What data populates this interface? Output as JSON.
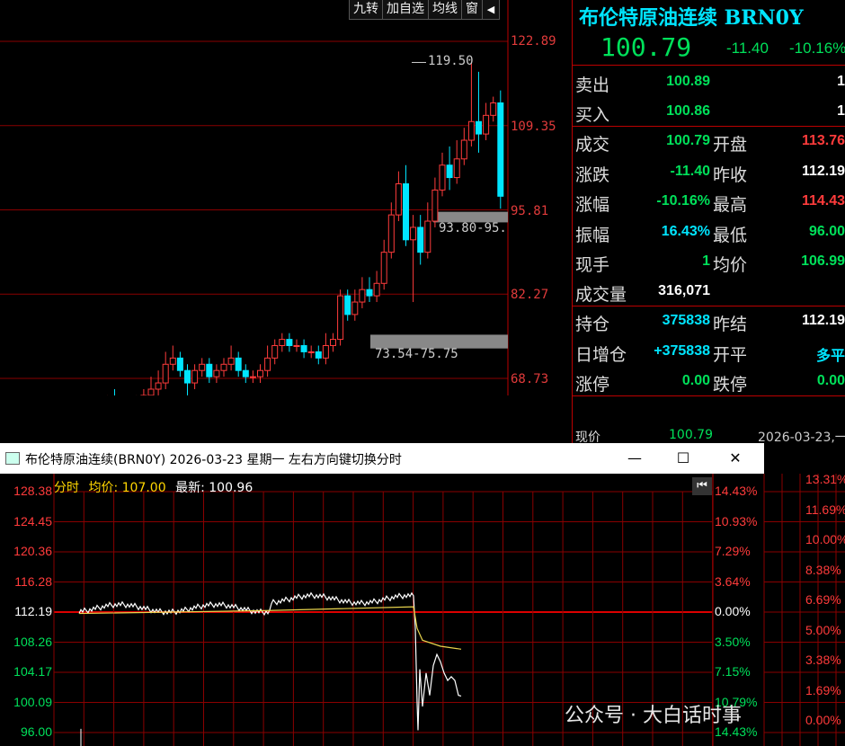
{
  "toolbar": {
    "b1": "九转",
    "b2": "加自选",
    "b3": "均线",
    "b4": "窗",
    "b5": "◀"
  },
  "kline": {
    "yticks": [
      "122.89",
      "109.35",
      "95.81",
      "82.27",
      "68.73"
    ],
    "high_label": "119.50",
    "zone1_label": "93.80-95.",
    "zone2_label": "73.54-75.75",
    "candles": [
      [
        56,
        57,
        59,
        56
      ],
      [
        59,
        58,
        60,
        57
      ],
      [
        58,
        57,
        60,
        56
      ],
      [
        57,
        58,
        59,
        56
      ],
      [
        58,
        57,
        59,
        56
      ],
      [
        57,
        56,
        58,
        55
      ],
      [
        56,
        55,
        57,
        54
      ],
      [
        55,
        56,
        57,
        54
      ],
      [
        56,
        58,
        59,
        55
      ],
      [
        58,
        60,
        61,
        57
      ],
      [
        60,
        62,
        63,
        59
      ],
      [
        62,
        63,
        65,
        61
      ],
      [
        63,
        61,
        64,
        60
      ],
      [
        61,
        62,
        63,
        60
      ],
      [
        62,
        65,
        66,
        61
      ],
      [
        65,
        63,
        67,
        62
      ],
      [
        63,
        64,
        65,
        62
      ],
      [
        64,
        63,
        65,
        61
      ],
      [
        63,
        64,
        66,
        62
      ],
      [
        64,
        66,
        67,
        63
      ],
      [
        66,
        67,
        69,
        65
      ],
      [
        67,
        68,
        70,
        66
      ],
      [
        68,
        71,
        73,
        67
      ],
      [
        71,
        72,
        74,
        70
      ],
      [
        72,
        70,
        73,
        69
      ],
      [
        70,
        68,
        71,
        66
      ],
      [
        68,
        70,
        71,
        67
      ],
      [
        70,
        71,
        72,
        69
      ],
      [
        71,
        69,
        72,
        68
      ],
      [
        69,
        70,
        71,
        68
      ],
      [
        70,
        71,
        72,
        69
      ],
      [
        71,
        72,
        74,
        70
      ],
      [
        72,
        70,
        73,
        69
      ],
      [
        70,
        69,
        71,
        68
      ],
      [
        69,
        69,
        70,
        68
      ],
      [
        69,
        70,
        71,
        68
      ],
      [
        70,
        72,
        74,
        69
      ],
      [
        72,
        74,
        75,
        71
      ],
      [
        74,
        75,
        76,
        73
      ],
      [
        75,
        74,
        76,
        73
      ],
      [
        74,
        74,
        75,
        73
      ],
      [
        74,
        73,
        75,
        72
      ],
      [
        73,
        73,
        74,
        72
      ],
      [
        73,
        72,
        74,
        71
      ],
      [
        72,
        74,
        76,
        71
      ],
      [
        74,
        75,
        76,
        73
      ],
      [
        75,
        82,
        83,
        74
      ],
      [
        82,
        79,
        83,
        78
      ],
      [
        79,
        81,
        83,
        78
      ],
      [
        81,
        83,
        85,
        80
      ],
      [
        83,
        82,
        85,
        81
      ],
      [
        82,
        84,
        86,
        81
      ],
      [
        84,
        89,
        91,
        83
      ],
      [
        89,
        95,
        97,
        88
      ],
      [
        95,
        100,
        102,
        94
      ],
      [
        100,
        91,
        103,
        90
      ],
      [
        91,
        93,
        95,
        81
      ],
      [
        93,
        89,
        95,
        87
      ],
      [
        89,
        94,
        97,
        88
      ],
      [
        94,
        99,
        101,
        93
      ],
      [
        99,
        103,
        105,
        98
      ],
      [
        103,
        101,
        106,
        99
      ],
      [
        101,
        104,
        107,
        100
      ],
      [
        104,
        107,
        109,
        103
      ],
      [
        107,
        110,
        119.5,
        106
      ],
      [
        110,
        108,
        118,
        105
      ],
      [
        108,
        111,
        113,
        107
      ],
      [
        111,
        113,
        114,
        110
      ],
      [
        113,
        98,
        115,
        96
      ]
    ]
  },
  "quote": {
    "title": "布伦特原油连续 BRN0Y",
    "price": "100.79",
    "change": "-11.40",
    "pct": "-10.16%",
    "sell_label": "卖出",
    "sell_val": "100.89",
    "sell_qty": "1",
    "buy_label": "买入",
    "buy_val": "100.86",
    "buy_qty": "1",
    "rows": [
      {
        "l1": "成交",
        "v1": "100.79",
        "c1": "green",
        "l2": "开盘",
        "v2": "113.76",
        "c2": "red"
      },
      {
        "l1": "涨跌",
        "v1": "-11.40",
        "c1": "green",
        "l2": "昨收",
        "v2": "112.19",
        "c2": "white"
      },
      {
        "l1": "涨幅",
        "v1": "-10.16%",
        "c1": "green",
        "l2": "最高",
        "v2": "114.43",
        "c2": "red"
      },
      {
        "l1": "振幅",
        "v1": "16.43%",
        "c1": "cyan",
        "l2": "最低",
        "v2": "96.00",
        "c2": "green"
      },
      {
        "l1": "现手",
        "v1": "1",
        "c1": "green",
        "l2": "均价",
        "v2": "106.99",
        "c2": "green"
      }
    ],
    "vol_label": "成交量",
    "vol_val": "316,071",
    "rows2": [
      {
        "l1": "持仓",
        "v1": "375838",
        "c1": "cyan",
        "l2": "昨结",
        "v2": "112.19",
        "c2": "white"
      },
      {
        "l1": "日增仓",
        "v1": "+375838",
        "c1": "cyan",
        "l2": "开平",
        "v2": "多平",
        "c2": "cyan"
      },
      {
        "l1": "涨停",
        "v1": "0.00",
        "c1": "green",
        "l2": "跌停",
        "v2": "0.00",
        "c2": "green"
      }
    ],
    "bottom_label": "现价",
    "bottom_val": "100.79",
    "bottom_date": "2026-03-23,一"
  },
  "window": {
    "title": "布伦特原油连续(BRN0Y) 2026-03-23 星期一    左右方向键切换分时",
    "minimize": "—",
    "maximize": "☐",
    "close": "✕"
  },
  "fenshi": {
    "label": "分时",
    "avg_label": "均价:",
    "avg_val": "107.00",
    "last_label": "最新:",
    "last_val": "100.96",
    "left_y": [
      "128.38",
      "124.45",
      "120.36",
      "116.28",
      "112.19",
      "108.26",
      "104.17",
      "100.09",
      "96.00"
    ],
    "right_y": [
      "14.43%",
      "10.93%",
      "7.29%",
      "3.64%",
      "0.00%",
      "3.50%",
      "7.15%",
      "10.79%",
      "14.43%"
    ],
    "far_right_y": [
      "13.31%",
      "11.69%",
      "10.00%",
      "8.38%",
      "6.69%",
      "5.00%",
      "3.38%",
      "1.69%",
      "0.00%"
    ]
  },
  "watermark": "公众号 · 大白话时事"
}
